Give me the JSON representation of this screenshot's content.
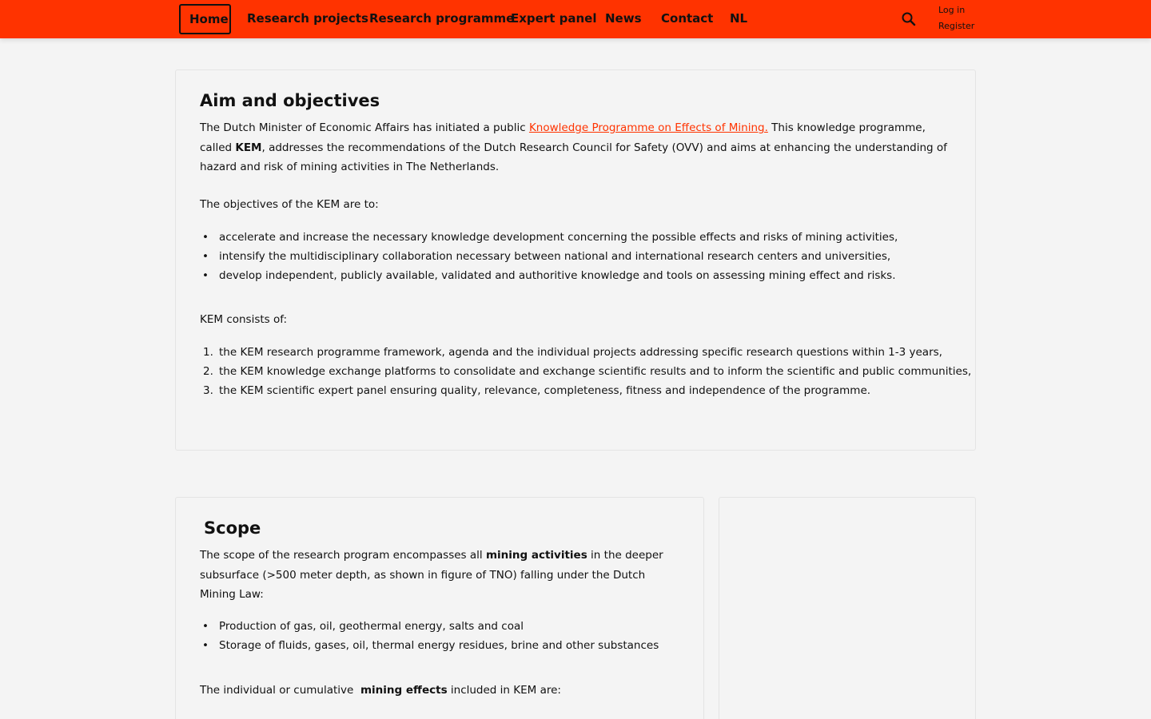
{
  "nav": {
    "items": [
      {
        "label": "Home",
        "active": true
      },
      {
        "label": "Research projects"
      },
      {
        "label": "Research programme"
      },
      {
        "label": "Expert panel"
      },
      {
        "label": "News"
      },
      {
        "label": "Contact"
      },
      {
        "label": "NL"
      }
    ],
    "search_icon": "search-icon",
    "login": "Log in",
    "register": "Register"
  },
  "colors": {
    "accent": "#ff3300",
    "background": "#f4f4f4",
    "text": "#111111"
  },
  "aim": {
    "title": "Aim and objectives",
    "intro_part1": "The Dutch Minister of Economic Affairs has initiated  a public ",
    "intro_link": "Knowledge Programme on Effects of Mining.",
    "intro_part2": " This knowledge programme, called ",
    "intro_bold": "KEM",
    "intro_part3": ", addresses the recommendations of the Dutch Research Council for Safety (OVV) and aims at enhancing the understanding of hazard and risk of mining activities in The Netherlands.",
    "objectives_intro": "The objectives of the KEM are to:",
    "objectives": [
      "accelerate and increase the necessary knowledge development concerning the possible effects and risks of mining activities,",
      "intensify the multidisciplinary collaboration necessary between national and international research centers and universities,",
      "develop independent, publicly available, validated and authoritive knowledge and tools on assessing mining effect and risks."
    ],
    "consists_intro": "KEM consists of:",
    "consists": [
      "the KEM research programme framework, agenda and the individual projects addressing specific research questions within 1-3 years,",
      "the KEM knowledge exchange platforms to consolidate and exchange scientific results and to inform the scientific and public communities,",
      "the KEM scientific expert panel ensuring quality, relevance, completeness, fitness and independence of the programme."
    ]
  },
  "scope": {
    "title": "Scope",
    "intro_part1": "The scope of the research program encompasses all ",
    "intro_bold": "mining activities",
    "intro_part2": " in the deeper subsurface (>500 meter depth, as shown in figure of TNO) falling under the Dutch Mining Law:",
    "activities": [
      "Production of gas, oil, geothermal energy, salts and coal",
      "Storage of fluids, gases, oil, thermal energy residues, brine and other substances"
    ],
    "effects_part1": "The individual or cumulative  ",
    "effects_bold": "mining effects",
    "effects_part2": " included in KEM are:"
  }
}
